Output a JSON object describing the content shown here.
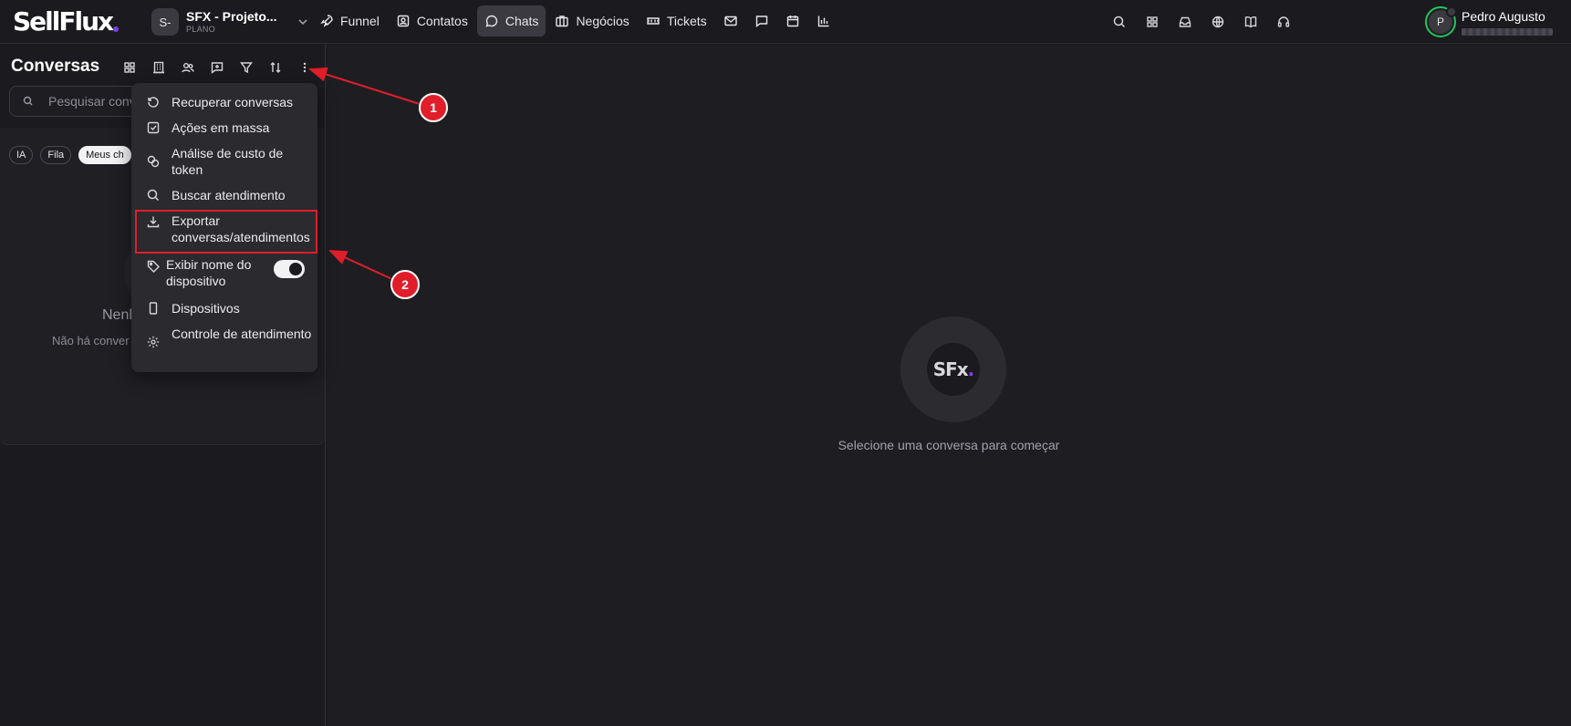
{
  "app": {
    "logo": "SellFlux"
  },
  "project": {
    "avatar": "S-",
    "name": "SFX - Projeto...",
    "plan": "PLANO"
  },
  "nav": [
    {
      "label": "Funnel",
      "icon": "rocket-icon"
    },
    {
      "label": "Contatos",
      "icon": "contact-icon"
    },
    {
      "label": "Chats",
      "icon": "chat-bubble-icon",
      "active": true
    },
    {
      "label": "Negócios",
      "icon": "briefcase-icon"
    },
    {
      "label": "Tickets",
      "icon": "ticket-icon"
    }
  ],
  "nav_icons": [
    "mail-icon",
    "message-square-icon",
    "calendar-icon",
    "bar-chart-icon"
  ],
  "right_tools": [
    "search-icon",
    "grid-icon",
    "inbox-icon",
    "globe-icon",
    "book-icon",
    "headset-icon"
  ],
  "user": {
    "initial": "P",
    "name": "Pedro Augusto"
  },
  "left_panel": {
    "title": "Conversas",
    "tools": [
      "layout-grid-icon",
      "building-icon",
      "users-icon",
      "message-plus-icon",
      "filter-icon",
      "sort-icon",
      "more-vertical-icon"
    ],
    "search_placeholder": "Pesquisar conve",
    "chips": [
      "IA",
      "Fila",
      "Meus ch"
    ],
    "empty_title": "Nenh",
    "empty_sub": "Não há conver"
  },
  "menu": {
    "items": [
      {
        "label": "Recuperar conversas",
        "icon": "rotate-ccw-icon"
      },
      {
        "label": "Ações em massa",
        "icon": "check-square-icon"
      },
      {
        "label": "Análise de custo de token",
        "icon": "coins-icon"
      },
      {
        "label": "Buscar atendimento",
        "icon": "search-icon"
      },
      {
        "label": "Exportar conversas/atendimentos",
        "icon": "download-icon"
      },
      {
        "label": "Exibir nome do dispositivo",
        "icon": "tag-icon",
        "toggle": true
      },
      {
        "label": "Dispositivos",
        "icon": "smartphone-icon"
      },
      {
        "label": "Controle de atendimento",
        "icon": "settings-icon"
      }
    ]
  },
  "main": {
    "logo_text": "SFx",
    "message": "Selecione uma conversa para começar"
  },
  "annotations": [
    {
      "label": "1"
    },
    {
      "label": "2"
    }
  ],
  "colors": {
    "accent": "#7b3fe4",
    "annotation": "#e11d2a",
    "online": "#22c55e"
  }
}
